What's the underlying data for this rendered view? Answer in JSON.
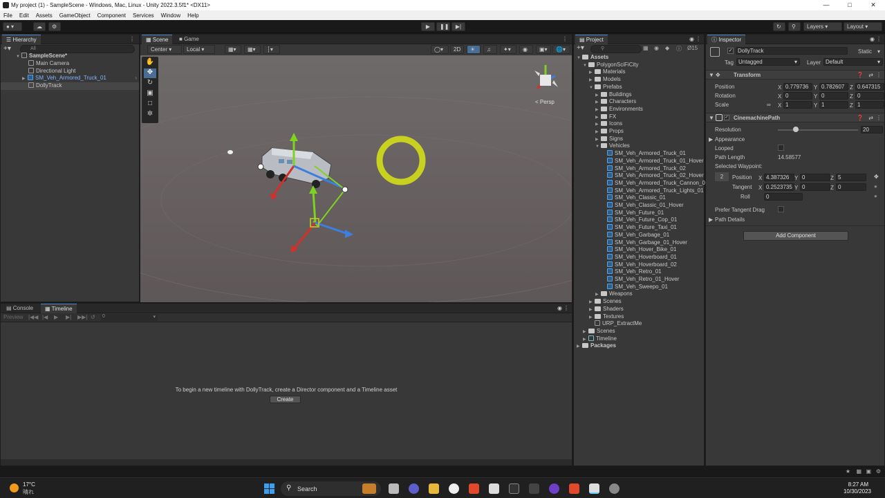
{
  "window": {
    "title": "My project (1) - SampleScene - Windows, Mac, Linux - Unity 2022.3.5f1* <DX11>"
  },
  "menu": [
    "File",
    "Edit",
    "Assets",
    "GameObject",
    "Component",
    "Services",
    "Window",
    "Help"
  ],
  "toolbar": {
    "layers": "Layers",
    "layout": "Layout"
  },
  "hierarchy": {
    "tab": "Hierarchy",
    "search_placeholder": "All",
    "scene": "SampleScene*",
    "items": [
      "Main Camera",
      "Directional Light",
      "SM_Veh_Armored_Truck_01",
      "DollyTrack"
    ]
  },
  "scene_view": {
    "tabs": [
      "Scene",
      "Game"
    ],
    "pivot": "Center",
    "space": "Local",
    "mode_2d": "2D",
    "persp": "< Persp"
  },
  "timeline": {
    "tabs": [
      "Console",
      "Timeline"
    ],
    "preview": "Preview",
    "frame": "0",
    "message": "To begin a new timeline with DollyTrack, create a Director component and a Timeline asset",
    "create_button": "Create"
  },
  "project": {
    "tab": "Project",
    "hidden_count": "15",
    "assets": "Assets",
    "root": "PolygonSciFiCity",
    "folders_top": [
      "Materials",
      "Models",
      "Prefabs"
    ],
    "prefab_folders": [
      "Buildings",
      "Characters",
      "Environments",
      "FX",
      "Icons",
      "Props",
      "Signs",
      "Vehicles"
    ],
    "vehicles": [
      "SM_Veh_Armored_Truck_01",
      "SM_Veh_Armored_Truck_01_Hover",
      "SM_Veh_Armored_Truck_02",
      "SM_Veh_Armored_Truck_02_Hover",
      "SM_Veh_Armored_Truck_Cannon_0",
      "SM_Veh_Armored_Truck_Lights_01",
      "SM_Veh_Classic_01",
      "SM_Veh_Classic_01_Hover",
      "SM_Veh_Future_01",
      "SM_Veh_Future_Cop_01",
      "SM_Veh_Future_Taxi_01",
      "SM_Veh_Garbage_01",
      "SM_Veh_Garbage_01_Hover",
      "SM_Veh_Hover_Bike_01",
      "SM_Veh_Hoverboard_01",
      "SM_Veh_Hoverboard_02",
      "SM_Veh_Retro_01",
      "SM_Veh_Retro_01_Hover",
      "SM_Veh_Sweepo_01"
    ],
    "after_vehicles": [
      "Weapons"
    ],
    "folders_bottom": [
      "Scenes",
      "Shaders",
      "Textures"
    ],
    "urp": "URP_ExtractMe",
    "root_others": [
      "Scenes",
      "Timeline"
    ],
    "packages": "Packages"
  },
  "inspector": {
    "tab": "Inspector",
    "object_name": "DollyTrack",
    "static": "Static",
    "tag_label": "Tag",
    "tag": "Untagged",
    "layer_label": "Layer",
    "layer": "Default",
    "transform": {
      "title": "Transform",
      "position_label": "Position",
      "rotation_label": "Rotation",
      "scale_label": "Scale",
      "position": [
        "0.779736",
        "0.782607",
        "0.647315"
      ],
      "rotation": [
        "0",
        "0",
        "0"
      ],
      "scale": [
        "1",
        "1",
        "1"
      ]
    },
    "cinemachine": {
      "title": "CinemachinePath",
      "resolution_label": "Resolution",
      "resolution": "20",
      "resolution_fraction": 0.22,
      "appearance": "Appearance",
      "looped": "Looped",
      "path_length_label": "Path Length",
      "path_length": "14.58577",
      "selected_waypoint": "Selected Waypoint:",
      "waypoint_index": "2",
      "wp_position_label": "Position",
      "wp_position": [
        "4.387326",
        "0",
        "5"
      ],
      "tangent_label": "Tangent",
      "tangent": [
        "0.2523735",
        "0",
        "0"
      ],
      "roll_label": "Roll",
      "roll": "0",
      "prefer_tangent": "Prefer Tangent Drag",
      "path_details": "Path Details"
    },
    "add_component": "Add Component"
  },
  "axis": {
    "x": "X",
    "y": "Y",
    "z": "Z"
  },
  "taskbar": {
    "temp": "17°C",
    "weather": "晴れ",
    "search": "Search",
    "time": "8:27 AM",
    "date": "10/30/2023"
  },
  "colors": {
    "accent": "#4d8bd4",
    "panel": "#383838",
    "ring": "#c8d020"
  }
}
